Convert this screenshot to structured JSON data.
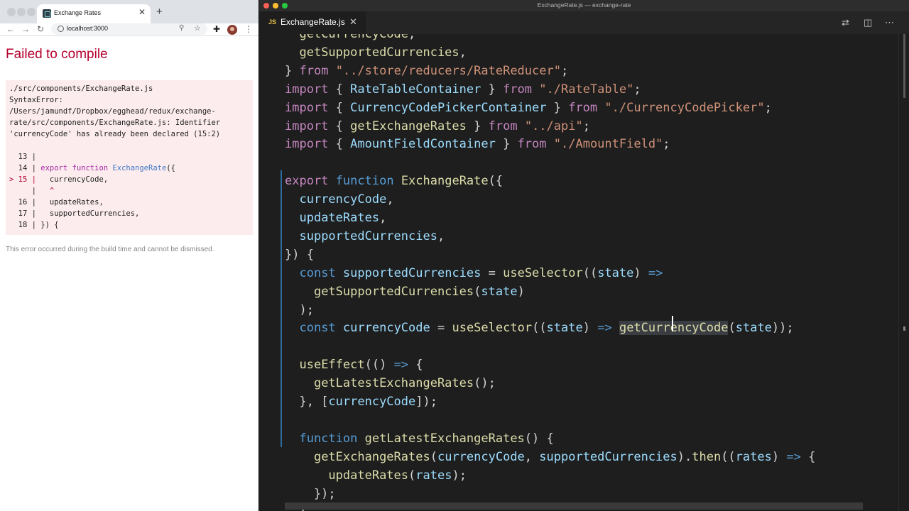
{
  "browser": {
    "tab_title": "Exchange Rates",
    "tab_close": "✕",
    "new_tab": "+",
    "url": "localhost:3000",
    "back_icon": "←",
    "forward_icon": "→",
    "reload_icon": "↻",
    "zoom_icon": "⚲",
    "star_icon": "☆",
    "extensions_icon": "✚",
    "menu_icon": "⋮"
  },
  "error": {
    "title": "Failed to compile",
    "message_lines": [
      "./src/components/ExchangeRate.js",
      "SyntaxError:",
      "/Users/jamundf/Dropbox/egghead/redux/exchange-",
      "rate/src/components/ExchangeRate.js: Identifier",
      "'currencyCode' has already been declared (15:2)"
    ],
    "code_frame": [
      {
        "num": "13",
        "marker": " ",
        "code": ""
      },
      {
        "num": "14",
        "marker": " ",
        "code": "export function ExchangeRate({"
      },
      {
        "num": "15",
        "marker": ">",
        "code": "  currencyCode,"
      },
      {
        "num": "",
        "marker": " ",
        "code": "  ^"
      },
      {
        "num": "16",
        "marker": " ",
        "code": "  updateRates,"
      },
      {
        "num": "17",
        "marker": " ",
        "code": "  supportedCurrencies,"
      },
      {
        "num": "18",
        "marker": " ",
        "code": "}) {"
      }
    ],
    "footer": "This error occurred during the build time and cannot be dismissed."
  },
  "vscode": {
    "window_title": "ExchangeRate.js — exchange-rate",
    "tab_badge": "JS",
    "tab_name": "ExchangeRate.js",
    "tab_close": "✕",
    "actions": [
      "⇄",
      "◫",
      "⋯"
    ]
  },
  "code_lines": [
    "  getCurrencyCode,",
    "  getSupportedCurrencies,",
    "} from \"../store/reducers/RateReducer\";",
    "import { RateTableContainer } from \"./RateTable\";",
    "import { CurrencyCodePickerContainer } from \"./CurrencyCodePicker\";",
    "import { getExchangeRates } from \"../api\";",
    "import { AmountFieldContainer } from \"./AmountField\";",
    "",
    "export function ExchangeRate({",
    "  currencyCode,",
    "  updateRates,",
    "  supportedCurrencies,",
    "}) {",
    "  const supportedCurrencies = useSelector((state) =>",
    "    getSupportedCurrencies(state)",
    "  );",
    "  const currencyCode = useSelector((state) => getCurrencyCode(state));",
    "",
    "  useEffect(() => {",
    "    getLatestExchangeRates();",
    "  }, [currencyCode]);",
    "",
    "  function getLatestExchangeRates() {",
    "    getExchangeRates(currencyCode, supportedCurrencies).then((rates) => {",
    "      updateRates(rates);",
    "    });",
    "  }"
  ]
}
